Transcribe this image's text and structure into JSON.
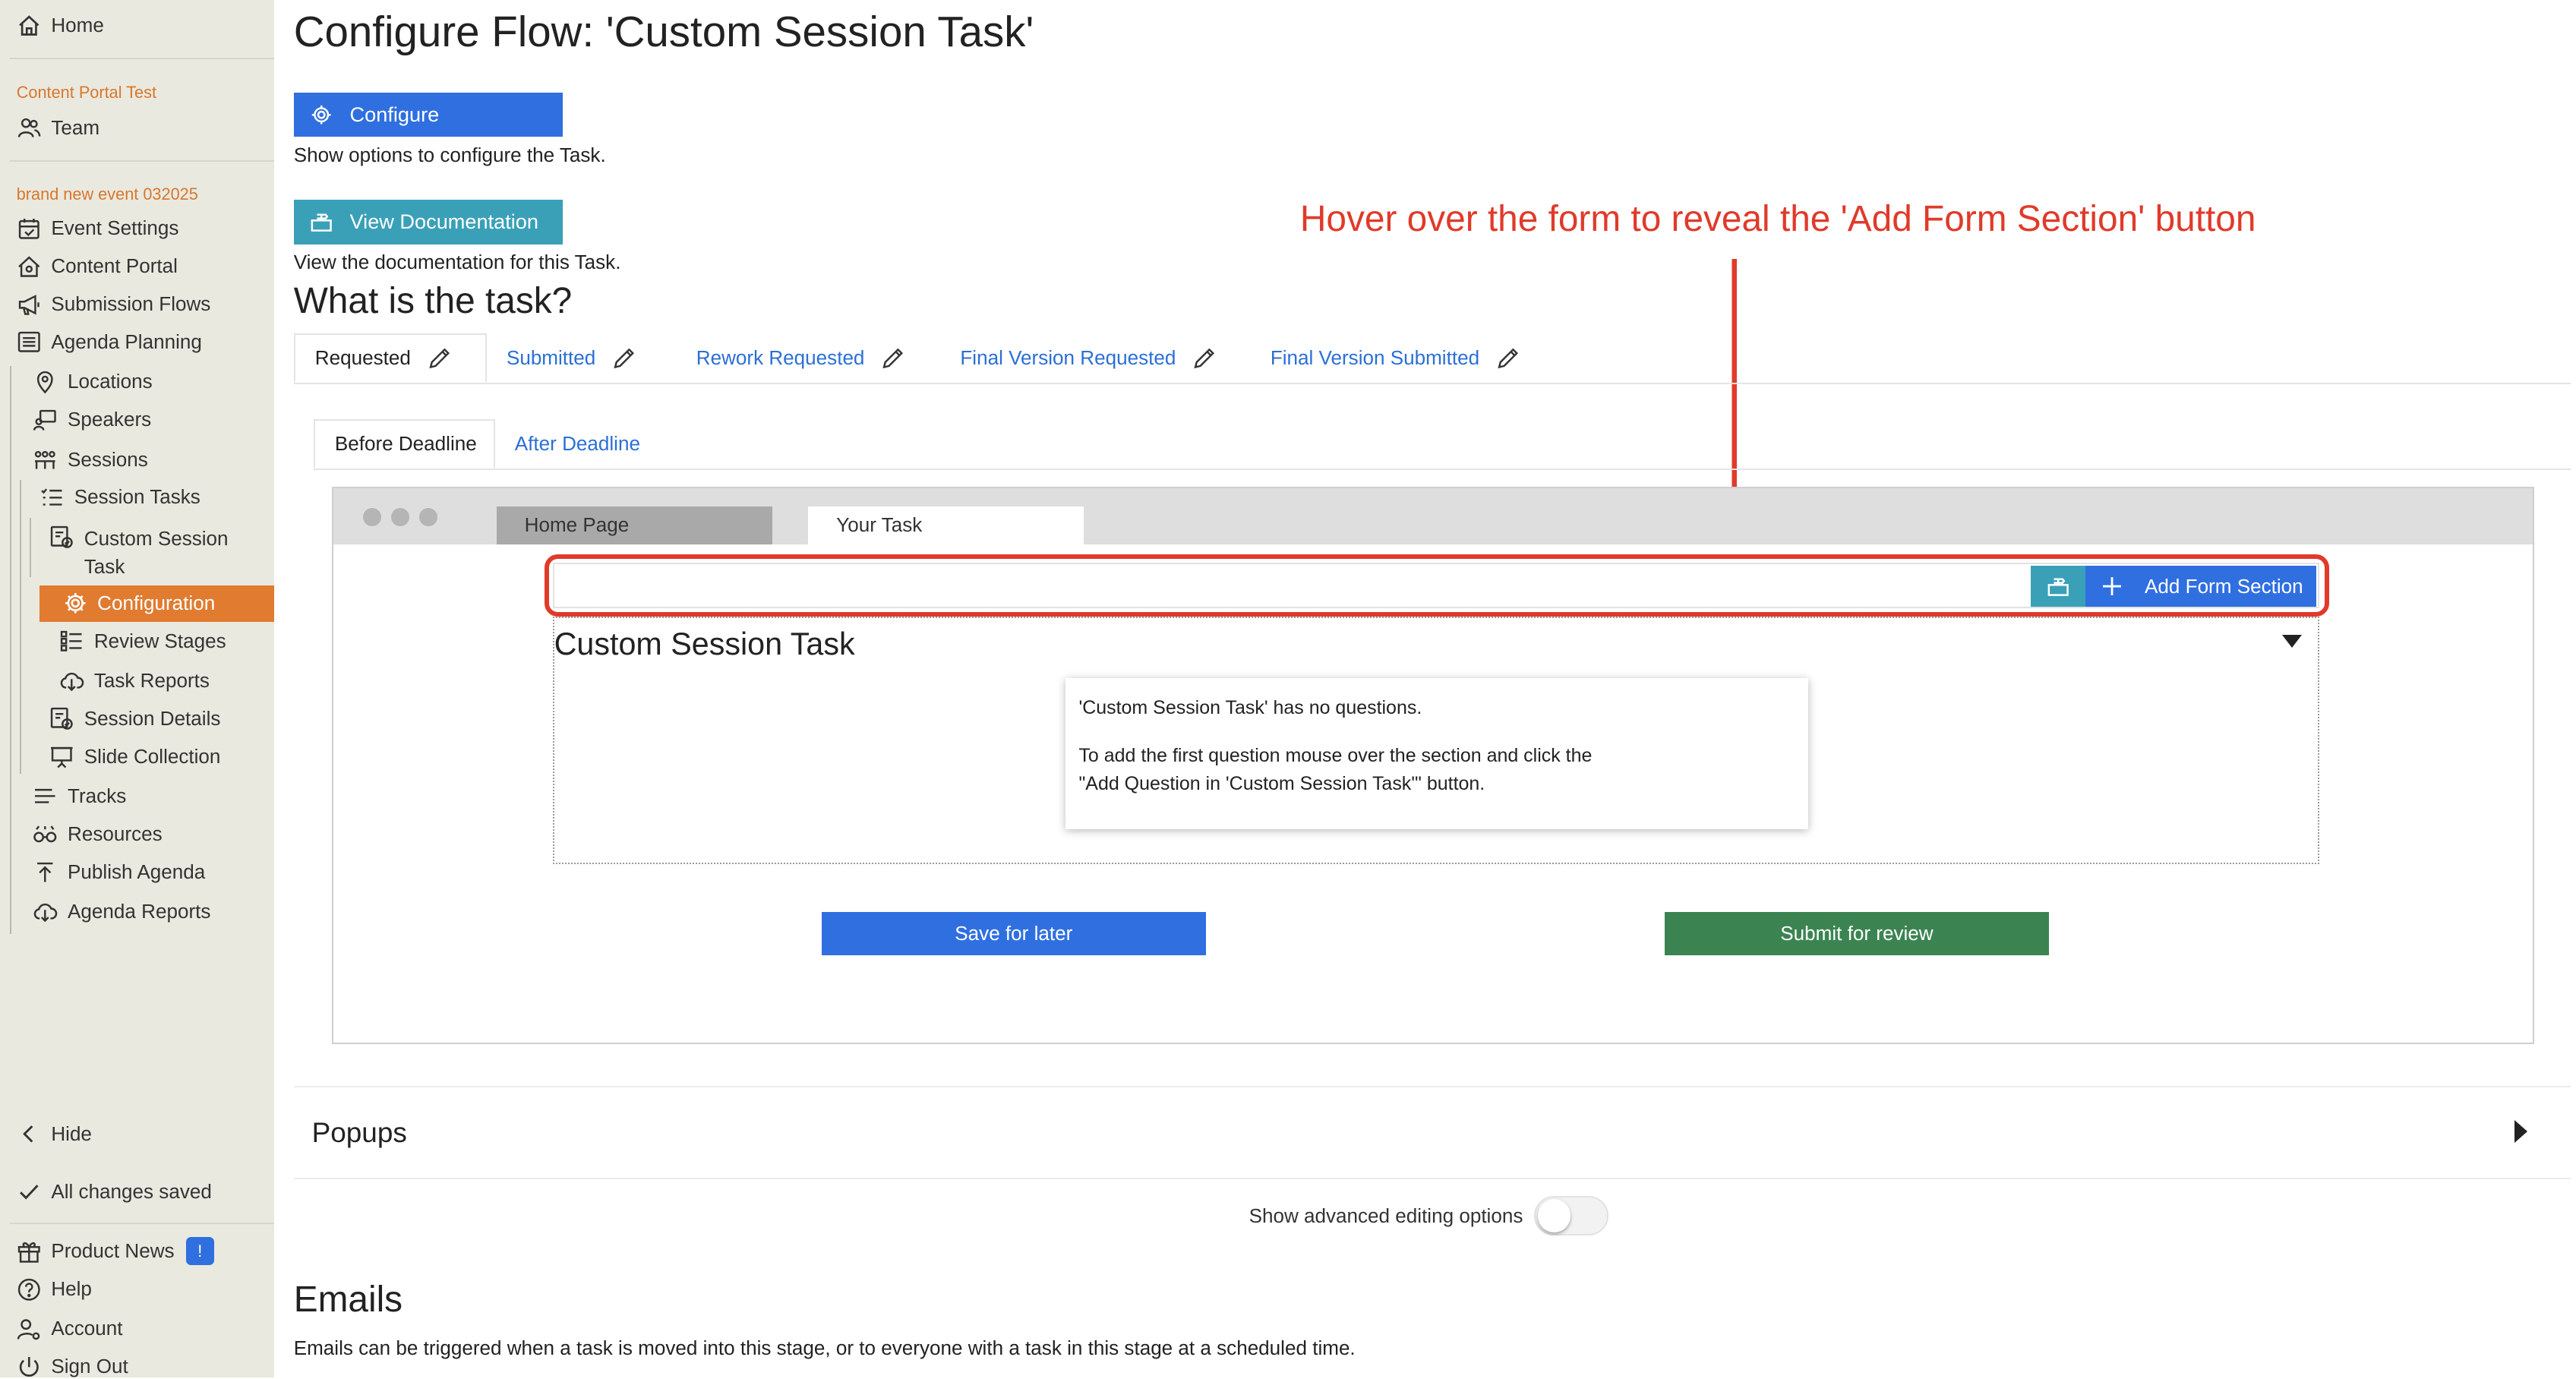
{
  "sidebar": {
    "home": "Home",
    "group1": "Content Portal Test",
    "team": "Team",
    "group2": "brand new event 032025",
    "event_settings": "Event Settings",
    "content_portal": "Content Portal",
    "submission_flows": "Submission Flows",
    "agenda_planning": "Agenda Planning",
    "locations": "Locations",
    "speakers": "Speakers",
    "sessions": "Sessions",
    "session_tasks": "Session Tasks",
    "custom_session_task_line1": "Custom Session",
    "custom_session_task_line2": "Task",
    "configuration": "Configuration",
    "review_stages": "Review Stages",
    "task_reports": "Task Reports",
    "session_details": "Session Details",
    "slide_collection": "Slide Collection",
    "tracks": "Tracks",
    "resources": "Resources",
    "publish_agenda": "Publish Agenda",
    "agenda_reports": "Agenda Reports",
    "hide": "Hide",
    "all_changes_saved": "All changes saved",
    "product_news": "Product News",
    "product_news_badge": "!",
    "help": "Help",
    "account": "Account",
    "sign_out": "Sign Out"
  },
  "main": {
    "title": "Configure Flow: 'Custom Session Task'",
    "configure_button": "Configure",
    "configure_desc": "Show options to configure the Task.",
    "docs_button": "View Documentation",
    "docs_desc": "View the documentation for this Task.",
    "task_heading": "What is the task?",
    "tabs": [
      "Requested",
      "Submitted",
      "Rework Requested",
      "Final Version Requested",
      "Final Version Submitted"
    ],
    "subtabs": [
      "Before Deadline",
      "After Deadline"
    ],
    "annotation": "Hover over the form to reveal the 'Add Form Section' button",
    "popups": "Popups",
    "advanced_label": "Show advanced editing options",
    "emails_heading": "Emails",
    "emails_desc": "Emails can be triggered when a task is moved into this stage, or to everyone with a task in this stage at a scheduled time."
  },
  "preview": {
    "browser_tabs": [
      "Home Page",
      "Your Task"
    ],
    "add_section_button": "Add Form Section",
    "section_title": "Custom Session Task",
    "no_questions": "'Custom Session Task' has no questions.",
    "instructions_line1": "To add the first question mouse over the section and click the",
    "instructions_line2": "\"Add Question in 'Custom Session Task'\" button.",
    "save_button": "Save for later",
    "submit_button": "Submit for review"
  },
  "colors": {
    "sidebar_bg": "#e9e9df",
    "active_item": "#e07b30",
    "group_label": "#d9772c",
    "primary_blue": "#2f6fe0",
    "teal": "#3aa0b8",
    "submit_green": "#3b8452",
    "annotation_red": "#e03a2a",
    "link_blue": "#2b6fd6"
  },
  "toggle_state": "off"
}
